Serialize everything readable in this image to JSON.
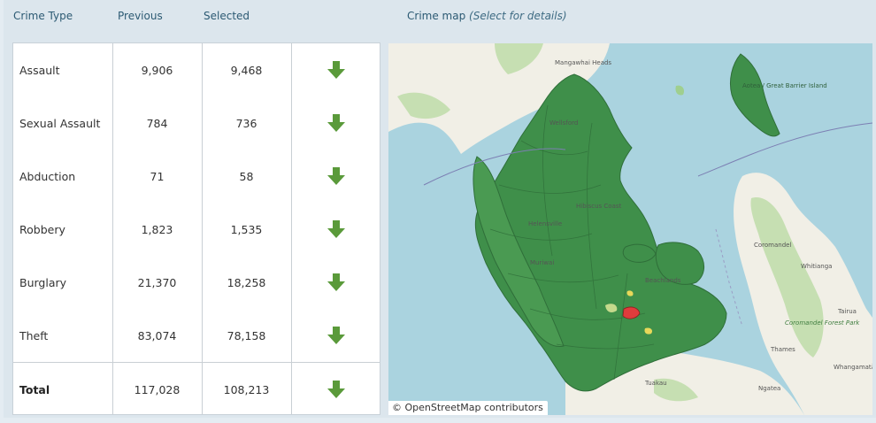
{
  "header": {
    "crime_type": "Crime Type",
    "previous": "Previous",
    "selected": "Selected",
    "map_title": "Crime map",
    "map_hint": "(Select for details)"
  },
  "rows": [
    {
      "name": "Assault",
      "previous": "9,906",
      "selected": "9,468",
      "trend": "down"
    },
    {
      "name": "Sexual Assault",
      "previous": "784",
      "selected": "736",
      "trend": "down"
    },
    {
      "name": "Abduction",
      "previous": "71",
      "selected": "58",
      "trend": "down"
    },
    {
      "name": "Robbery",
      "previous": "1,823",
      "selected": "1,535",
      "trend": "down"
    },
    {
      "name": "Burglary",
      "previous": "21,370",
      "selected": "18,258",
      "trend": "down"
    },
    {
      "name": "Theft",
      "previous": "83,074",
      "selected": "78,158",
      "trend": "down"
    }
  ],
  "total": {
    "name": "Total",
    "previous": "117,028",
    "selected": "108,213",
    "trend": "down"
  },
  "map": {
    "attribution": "© OpenStreetMap contributors",
    "places": [
      "Mangawhai Heads",
      "Wellsford",
      "Hibiscus Coast",
      "Helensville",
      "Muriwai",
      "Beachlands",
      "Tuakau",
      "Coromandel",
      "Whitianga",
      "Tairua",
      "Thames",
      "Whangamatā",
      "Ngatea",
      "Coromandel Forest Park",
      "Aotea / Great Barrier Island"
    ]
  },
  "colors": {
    "arrow": "#5a9a3a",
    "region": "#3f8f4a",
    "water": "#aad3df",
    "land": "#f1efe6",
    "park": "#c6dfb2",
    "highlight": "#e03c3c"
  },
  "icons": {
    "trend_down": "down-arrow-icon"
  }
}
